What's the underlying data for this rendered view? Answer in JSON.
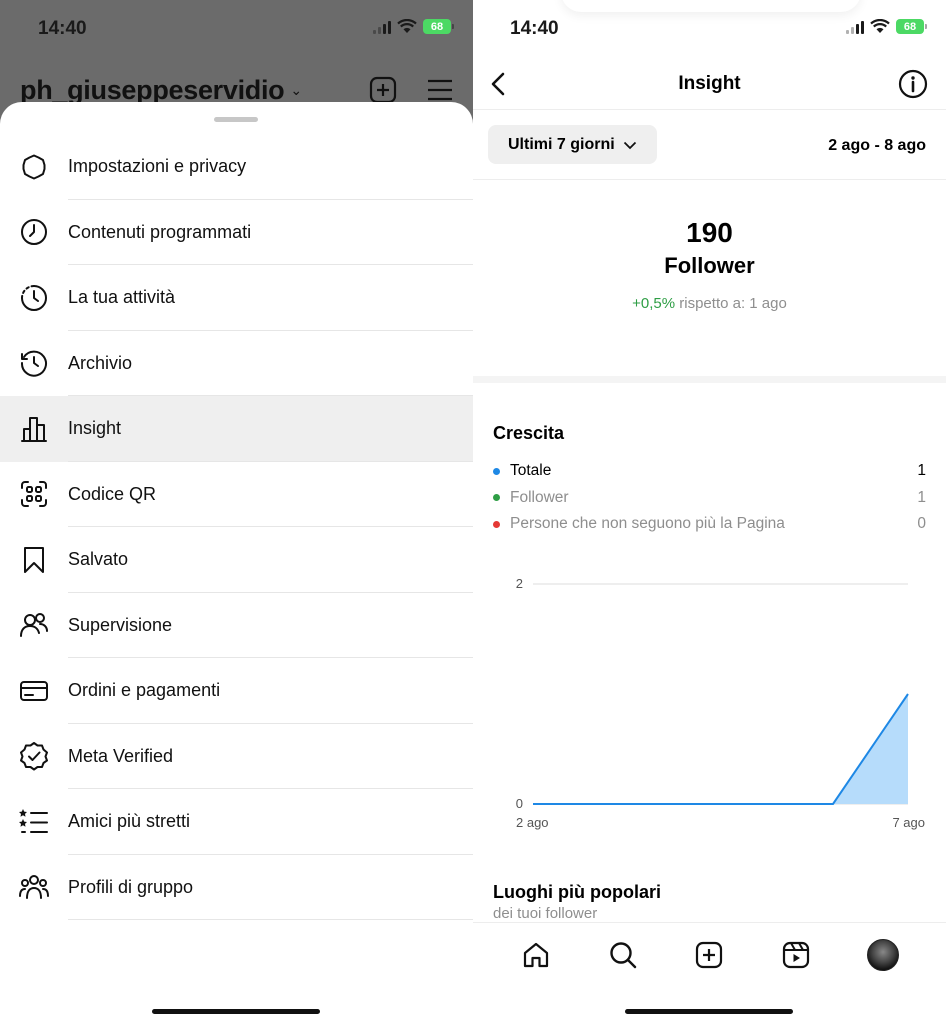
{
  "left": {
    "status_time": "14:40",
    "battery": "68",
    "username": "ph_giuseppeservidio",
    "menu": [
      {
        "label": "Impostazioni e privacy",
        "icon": "gear-icon",
        "active": false
      },
      {
        "label": "Contenuti programmati",
        "icon": "clock-icon",
        "active": false
      },
      {
        "label": "La tua attività",
        "icon": "activity-icon",
        "active": false
      },
      {
        "label": "Archivio",
        "icon": "archive-icon",
        "active": false
      },
      {
        "label": "Insight",
        "icon": "bar-chart-icon",
        "active": true
      },
      {
        "label": "Codice QR",
        "icon": "qr-code-icon",
        "active": false
      },
      {
        "label": "Salvato",
        "icon": "bookmark-icon",
        "active": false
      },
      {
        "label": "Supervisione",
        "icon": "supervision-icon",
        "active": false
      },
      {
        "label": "Ordini e pagamenti",
        "icon": "credit-card-icon",
        "active": false
      },
      {
        "label": "Meta Verified",
        "icon": "verified-badge-icon",
        "active": false
      },
      {
        "label": "Amici più stretti",
        "icon": "close-friends-icon",
        "active": false
      },
      {
        "label": "Profili di gruppo",
        "icon": "group-profiles-icon",
        "active": false
      }
    ]
  },
  "right": {
    "status_time": "14:40",
    "battery": "68",
    "title": "Insight",
    "range_label": "Ultimi 7 giorni",
    "date_range": "2 ago - 8 ago",
    "summary": {
      "count": "190",
      "label": "Follower",
      "delta": "+0,5%",
      "delta_suffix": "rispetto a: 1 ago"
    },
    "growth": {
      "title": "Crescita",
      "legend": [
        {
          "name": "Totale",
          "value": "1",
          "color": "#1e88e5"
        },
        {
          "name": "Follower",
          "value": "1",
          "color": "#2e9e45"
        },
        {
          "name": "Persone che non seguono più la Pagina",
          "value": "0",
          "color": "#e53935"
        }
      ]
    },
    "places": {
      "title": "Luoghi più popolari",
      "subtitle": "dei tuoi follower"
    }
  },
  "chart_data": {
    "type": "area",
    "title": "",
    "x": [
      "2 ago",
      "3 ago",
      "4 ago",
      "5 ago",
      "6 ago",
      "7 ago"
    ],
    "x_tick_labels": [
      "2 ago",
      "7 ago"
    ],
    "series": [
      {
        "name": "Totale",
        "values": [
          0,
          0,
          0,
          0,
          0,
          1.0
        ],
        "color": "#1e88e5"
      }
    ],
    "yticks": [
      0,
      2
    ],
    "ylim": [
      0,
      2
    ],
    "grid": true
  }
}
